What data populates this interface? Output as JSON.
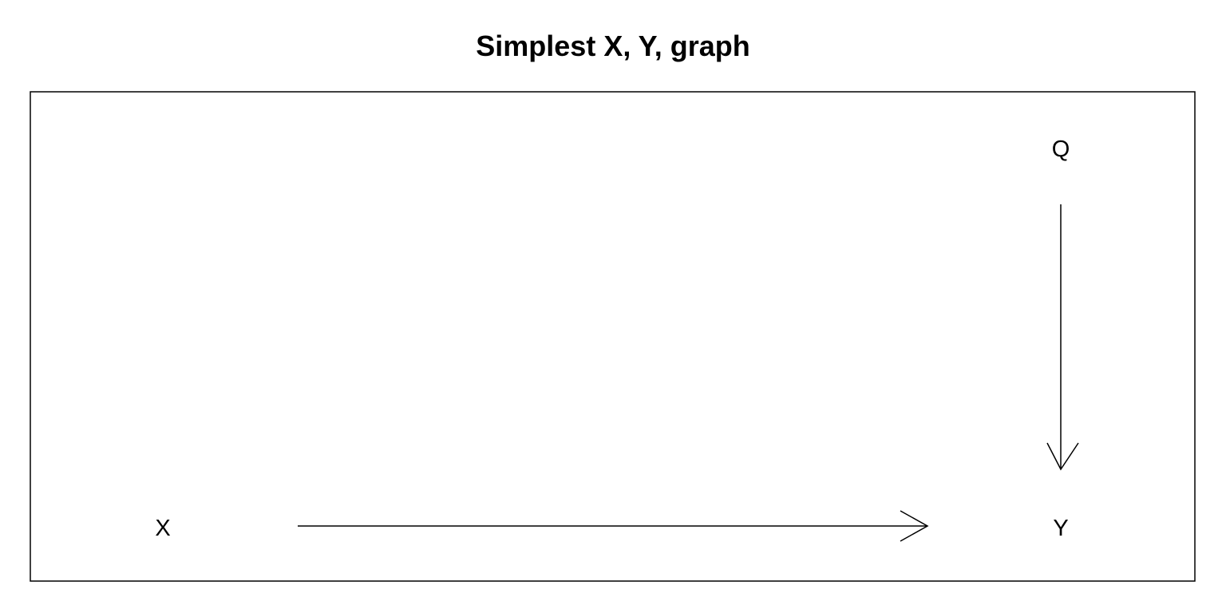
{
  "title": "Simplest X, Y, graph",
  "nodes": [
    {
      "id": "X",
      "label": "X"
    },
    {
      "id": "Y",
      "label": "Y"
    },
    {
      "id": "Q",
      "label": "Q"
    }
  ],
  "edges": [
    {
      "from": "X",
      "to": "Y"
    },
    {
      "from": "Q",
      "to": "Y"
    }
  ],
  "colors": {
    "stroke": "#000000",
    "background": "#ffffff"
  }
}
